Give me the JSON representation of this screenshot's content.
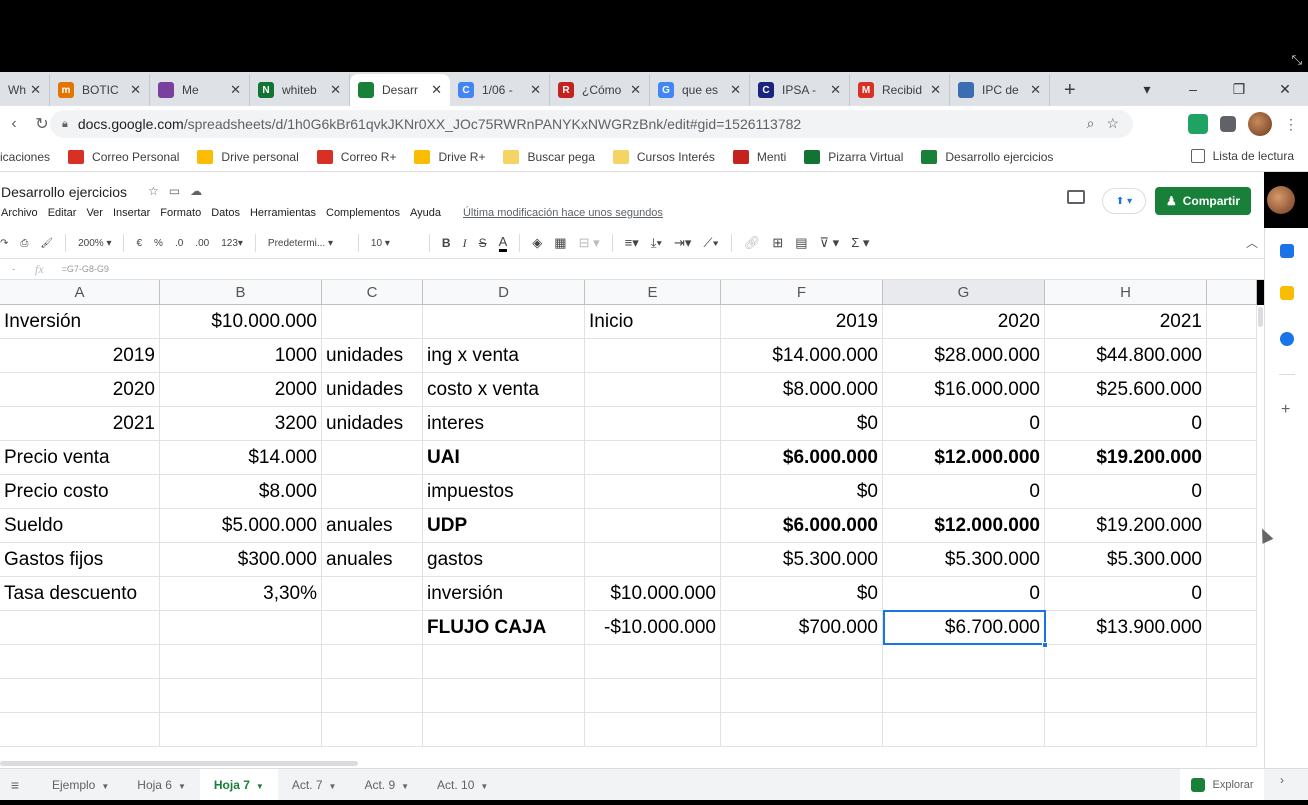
{
  "browser": {
    "tabs": [
      {
        "label": "Wh",
        "color": "#e0e0e0",
        "glyph": "",
        "active": false
      },
      {
        "label": "BOTIC",
        "color": "#e37400",
        "glyph": "m",
        "active": false
      },
      {
        "label": "Me",
        "color": "#7b3fa0",
        "glyph": "",
        "active": false
      },
      {
        "label": "whiteb",
        "color": "#137333",
        "glyph": "N",
        "active": false
      },
      {
        "label": "Desarr",
        "color": "#188038",
        "glyph": "",
        "active": true
      },
      {
        "label": "1/06 -",
        "color": "#4285f4",
        "glyph": "C",
        "active": false
      },
      {
        "label": "¿Cómo",
        "color": "#c5221f",
        "glyph": "R",
        "active": false
      },
      {
        "label": "que es",
        "color": "#4285f4",
        "glyph": "G",
        "active": false
      },
      {
        "label": "IPSA -",
        "color": "#1a237e",
        "glyph": "C",
        "active": false
      },
      {
        "label": "Recibid",
        "color": "#d93025",
        "glyph": "M",
        "active": false
      },
      {
        "label": "IPC de",
        "color": "#3b6db3",
        "glyph": "",
        "active": false
      }
    ],
    "url_domain": "docs.google.com",
    "url_path": "/spreadsheets/d/1h0G6kBr61qvkJKNr0XX_JOc75RWRnPANYKxNWGRzBnk/edit#gid=1526113782",
    "bookmarks": [
      {
        "label": "icaciones",
        "color": ""
      },
      {
        "label": "Correo Personal",
        "color": "#d93025"
      },
      {
        "label": "Drive personal",
        "color": "#fbbc04"
      },
      {
        "label": "Correo R+",
        "color": "#d93025"
      },
      {
        "label": "Drive R+",
        "color": "#fbbc04"
      },
      {
        "label": "Buscar pega",
        "color": "#f6d365"
      },
      {
        "label": "Cursos Interés",
        "color": "#f6d365"
      },
      {
        "label": "Menti",
        "color": "#c5221f"
      },
      {
        "label": "Pizarra Virtual",
        "color": "#137333"
      },
      {
        "label": "Desarrollo ejercicios",
        "color": "#188038"
      }
    ],
    "reading_list": "Lista de lectura"
  },
  "doc": {
    "title": "Desarrollo ejercicios",
    "menu": [
      "Archivo",
      "Editar",
      "Ver",
      "Insertar",
      "Formato",
      "Datos",
      "Herramientas",
      "Complementos",
      "Ayuda"
    ],
    "last_edit": "Última modificación hace unos segundos",
    "share_label": "Compartir"
  },
  "toolbar": {
    "zoom": "200%",
    "currency": "€",
    "percent": "%",
    "dec_less": ".0",
    "dec_more": ".00",
    "more_formats": "123",
    "font": "Predetermi...",
    "font_size": "10",
    "bold": "B",
    "italic": "I",
    "strike": "S",
    "text_color": "A",
    "sum": "Σ"
  },
  "formula": {
    "cell_ref": "-",
    "fx": "fx",
    "content": "=G7-G8-G9"
  },
  "sheet": {
    "columns": [
      {
        "label": "A",
        "selected": false
      },
      {
        "label": "B",
        "selected": false
      },
      {
        "label": "C",
        "selected": false
      },
      {
        "label": "D",
        "selected": false
      },
      {
        "label": "E",
        "selected": false
      },
      {
        "label": "F",
        "selected": false
      },
      {
        "label": "G",
        "selected": true
      },
      {
        "label": "H",
        "selected": false
      }
    ],
    "rows": [
      [
        "Inversión",
        "$10.000.000",
        "",
        "",
        "Inicio",
        "2019",
        "2020",
        "2021"
      ],
      [
        "2019",
        "1000",
        "unidades",
        "ing x venta",
        "",
        "$14.000.000",
        "$28.000.000",
        "$44.800.000"
      ],
      [
        "2020",
        "2000",
        "unidades",
        "costo x venta",
        "",
        "$8.000.000",
        "$16.000.000",
        "$25.600.000"
      ],
      [
        "2021",
        "3200",
        "unidades",
        "interes",
        "",
        "$0",
        "0",
        "0"
      ],
      [
        "Precio venta",
        "$14.000",
        "",
        "UAI",
        "",
        "$6.000.000",
        "$12.000.000",
        "$19.200.000"
      ],
      [
        "Precio costo",
        "$8.000",
        "",
        "impuestos",
        "",
        "$0",
        "0",
        "0"
      ],
      [
        "Sueldo",
        "$5.000.000",
        "anuales",
        "UDP",
        "",
        "$6.000.000",
        "$12.000.000",
        "$19.200.000"
      ],
      [
        "Gastos fijos",
        "$300.000",
        "anuales",
        "gastos",
        "",
        "$5.300.000",
        "$5.300.000",
        "$5.300.000"
      ],
      [
        "Tasa descuento",
        "3,30%",
        "",
        "inversión",
        "$10.000.000",
        "$0",
        "0",
        "0"
      ],
      [
        "",
        "",
        "",
        "FLUJO CAJA",
        "-$10.000.000",
        "$700.000",
        "$6.700.000",
        "$13.900.000"
      ],
      [
        "",
        "",
        "",
        "",
        "",
        "",
        "",
        ""
      ],
      [
        "",
        "",
        "",
        "",
        "",
        "",
        "",
        ""
      ],
      [
        "",
        "",
        "",
        "",
        "",
        "",
        "",
        ""
      ]
    ],
    "align": [
      [
        "l",
        "r",
        "l",
        "l",
        "l",
        "r",
        "r",
        "r"
      ],
      [
        "r",
        "r",
        "l",
        "l",
        "l",
        "r",
        "r",
        "r"
      ],
      [
        "r",
        "r",
        "l",
        "l",
        "l",
        "r",
        "r",
        "r"
      ],
      [
        "r",
        "r",
        "l",
        "l",
        "l",
        "r",
        "r",
        "r"
      ],
      [
        "l",
        "r",
        "l",
        "l",
        "l",
        "r",
        "r",
        "r"
      ],
      [
        "l",
        "r",
        "l",
        "l",
        "l",
        "r",
        "r",
        "r"
      ],
      [
        "l",
        "r",
        "l",
        "l",
        "l",
        "r",
        "r",
        "r"
      ],
      [
        "l",
        "r",
        "l",
        "l",
        "l",
        "r",
        "r",
        "r"
      ],
      [
        "l",
        "r",
        "l",
        "l",
        "r",
        "r",
        "r",
        "r"
      ],
      [
        "l",
        "r",
        "l",
        "l",
        "r",
        "r",
        "r",
        "r"
      ],
      [
        "l",
        "l",
        "l",
        "l",
        "l",
        "l",
        "l",
        "l"
      ],
      [
        "l",
        "l",
        "l",
        "l",
        "l",
        "l",
        "l",
        "l"
      ],
      [
        "l",
        "l",
        "l",
        "l",
        "l",
        "l",
        "l",
        "l"
      ]
    ],
    "bold_cells": [
      "4-3",
      "4-5",
      "4-6",
      "4-7",
      "6-3",
      "6-5",
      "6-6",
      "9-3"
    ],
    "selected_cell": "G10"
  },
  "sheet_tabs": [
    {
      "label": "Ejemplo",
      "active": false
    },
    {
      "label": "Hoja 6",
      "active": false
    },
    {
      "label": "Hoja 7",
      "active": true
    },
    {
      "label": "Act. 7",
      "active": false
    },
    {
      "label": "Act. 9",
      "active": false
    },
    {
      "label": "Act. 10",
      "active": false
    }
  ],
  "explore_label": "Explorar"
}
